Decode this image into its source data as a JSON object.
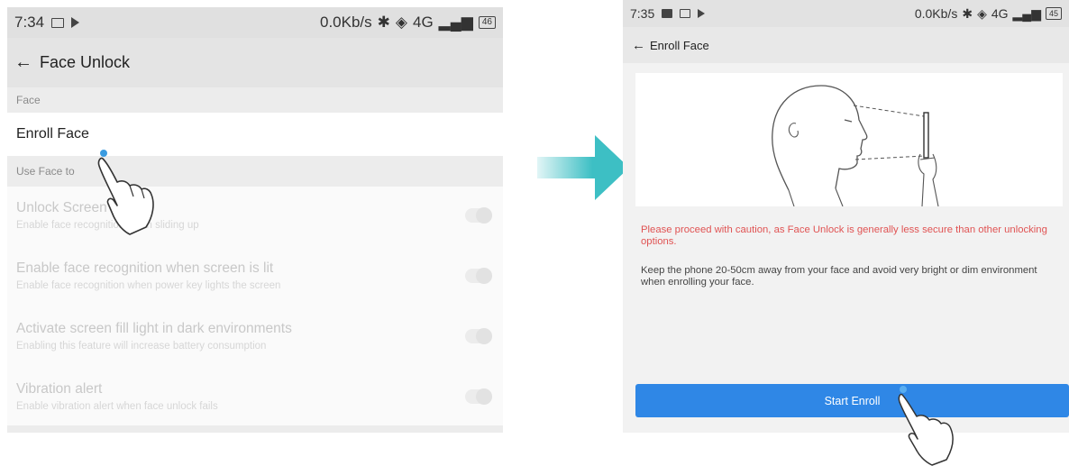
{
  "left_screen": {
    "status_bar": {
      "time": "7:34",
      "network": "0.0Kb/s",
      "signal": "4G",
      "battery": "46"
    },
    "title_bar": {
      "back_icon": "arrow-left-icon",
      "title": "Face Unlock"
    },
    "section_face": "Face",
    "enroll_face": "Enroll Face",
    "section_use_face": "Use Face to",
    "options": [
      {
        "title": "Unlock Screen",
        "subtitle": "Enable face recognition when sliding up",
        "enabled": false
      },
      {
        "title": "Enable face recognition when screen is lit",
        "subtitle": "Enable face recognition when power key lights the screen",
        "enabled": false
      },
      {
        "title": "Activate screen fill light in dark environments",
        "subtitle": "Enabling this feature will increase battery consumption",
        "enabled": false
      },
      {
        "title": "Vibration alert",
        "subtitle": "Enable vibration alert when face unlock fails",
        "enabled": false
      }
    ]
  },
  "arrow": {
    "icon": "arrow-right-icon",
    "color": "#3dbfc4"
  },
  "right_screen": {
    "status_bar": {
      "time": "7:35",
      "network": "0.0Kb/s",
      "signal": "4G",
      "battery": "45"
    },
    "title_bar": {
      "back_icon": "arrow-left-icon",
      "title": "Enroll Face"
    },
    "illustration": "face-scan-illustration",
    "warning": "Please proceed with caution, as Face Unlock is generally less secure than other unlocking options.",
    "info": "Keep the phone 20-50cm away from your face and avoid very bright or dim environment when enrolling your face.",
    "start_button": "Start Enroll"
  },
  "colors": {
    "accent_button": "#2f87e6",
    "warning_text": "#e05353",
    "arrow": "#3dbfc4"
  }
}
